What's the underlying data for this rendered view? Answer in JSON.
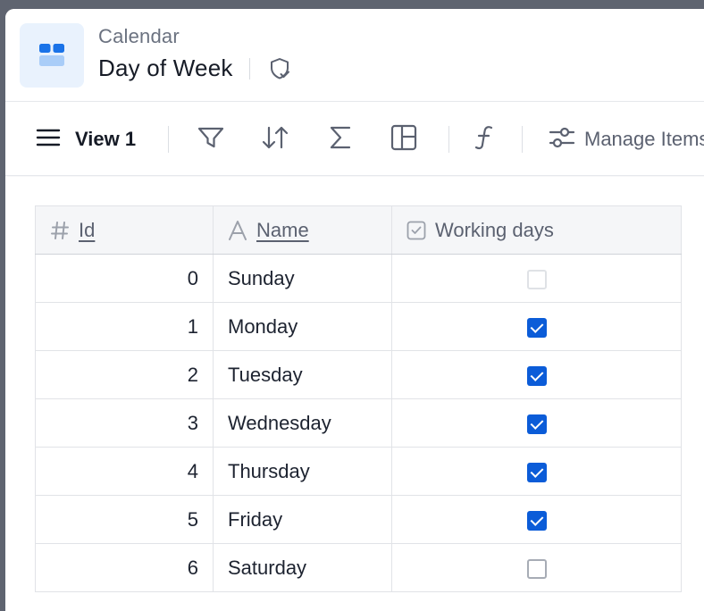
{
  "header": {
    "breadcrumb": "Calendar",
    "title": "Day of Week"
  },
  "toolbar": {
    "view_label": "View 1",
    "manage_label": "Manage Items"
  },
  "table": {
    "columns": [
      {
        "key": "id",
        "label": "Id",
        "icon": "hash-icon"
      },
      {
        "key": "name",
        "label": "Name",
        "icon": "text-type-icon"
      },
      {
        "key": "working_days",
        "label": "Working days",
        "icon": "checkbox-type-icon"
      }
    ],
    "rows": [
      {
        "id": "0",
        "name": "Sunday",
        "working": false
      },
      {
        "id": "1",
        "name": "Monday",
        "working": true
      },
      {
        "id": "2",
        "name": "Tuesday",
        "working": true
      },
      {
        "id": "3",
        "name": "Wednesday",
        "working": true
      },
      {
        "id": "4",
        "name": "Thursday",
        "working": true
      },
      {
        "id": "5",
        "name": "Friday",
        "working": true
      },
      {
        "id": "6",
        "name": "Saturday",
        "working": false
      }
    ]
  },
  "colors": {
    "accent": "#0b5cd8",
    "app_icon_bg": "#e9f2fd",
    "app_icon": "#1a73e8"
  }
}
